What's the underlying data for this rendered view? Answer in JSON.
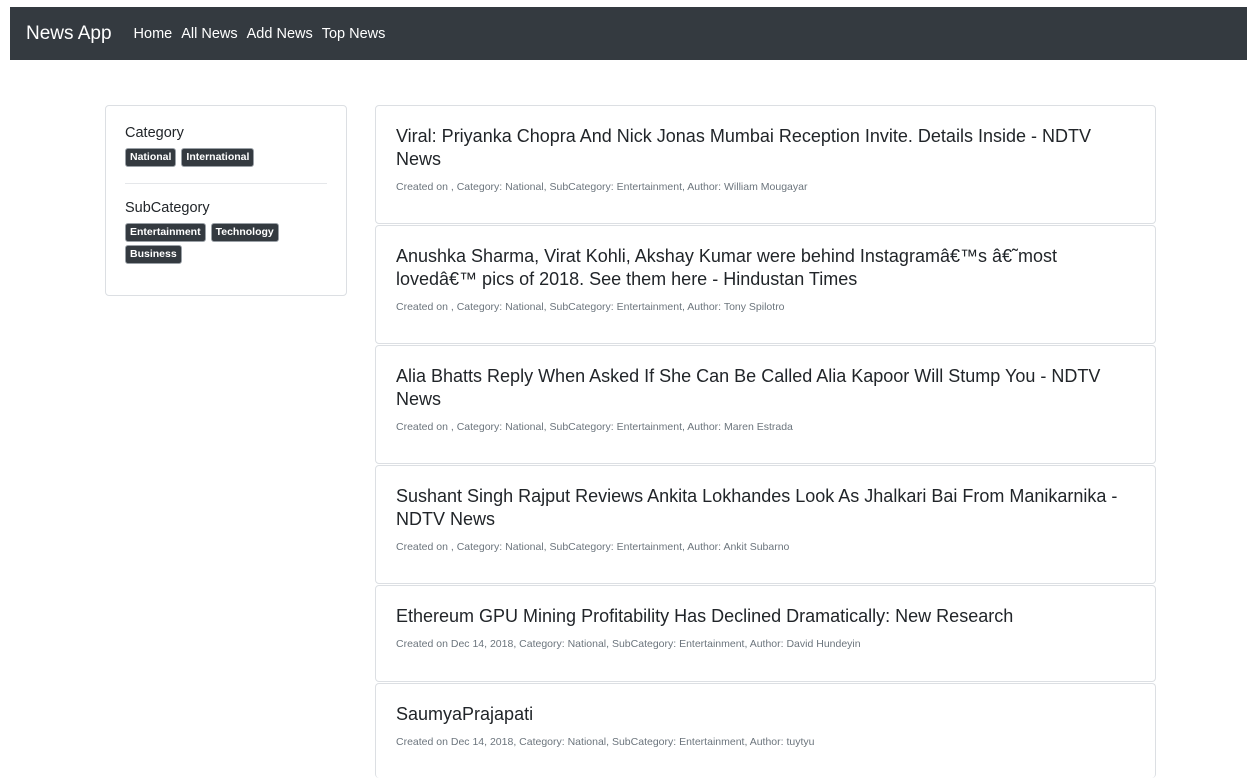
{
  "navbar": {
    "brand": "News App",
    "links": [
      "Home",
      "All News",
      "Add News",
      "Top News"
    ]
  },
  "sidebar": {
    "category_heading": "Category",
    "categories": [
      "National",
      "International"
    ],
    "subcategory_heading": "SubCategory",
    "subcategories": [
      "Entertainment",
      "Technology",
      "Business"
    ]
  },
  "news": [
    {
      "title": "Viral: Priyanka Chopra And Nick Jonas Mumbai Reception Invite. Details Inside - NDTV News",
      "meta": "Created on , Category: National, SubCategory: Entertainment, Author: William Mougayar"
    },
    {
      "title": "Anushka Sharma, Virat Kohli, Akshay Kumar were behind Instagramâ€™s â€˜most lovedâ€™ pics of 2018. See them here - Hindustan Times",
      "meta": "Created on , Category: National, SubCategory: Entertainment, Author: Tony Spilotro"
    },
    {
      "title": "Alia Bhatts Reply When Asked If She Can Be Called Alia Kapoor Will Stump You - NDTV News",
      "meta": "Created on , Category: National, SubCategory: Entertainment, Author: Maren Estrada"
    },
    {
      "title": "Sushant Singh Rajput Reviews Ankita Lokhandes Look As Jhalkari Bai From Manikarnika - NDTV News",
      "meta": "Created on , Category: National, SubCategory: Entertainment, Author: Ankit Subarno"
    },
    {
      "title": "Ethereum GPU Mining Profitability Has Declined Dramatically: New Research",
      "meta": "Created on Dec 14, 2018, Category: National, SubCategory: Entertainment, Author: David Hundeyin"
    },
    {
      "title": "SaumyaPrajapati",
      "meta": "Created on Dec 14, 2018, Category: National, SubCategory: Entertainment, Author: tuytyu"
    }
  ]
}
